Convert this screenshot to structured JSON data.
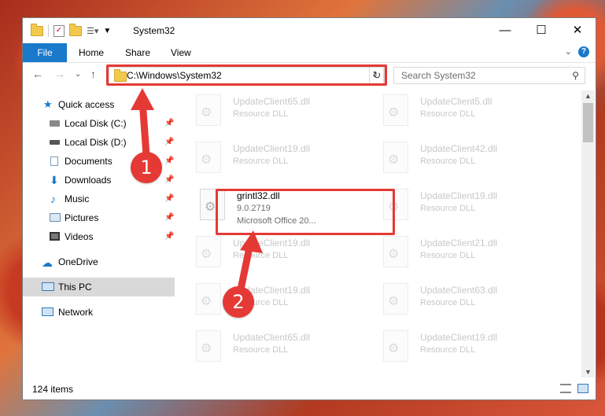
{
  "window": {
    "title": "System32",
    "buttons": {
      "minimize": "—",
      "maximize": "☐",
      "close": "✕"
    }
  },
  "ribbon": {
    "file": "File",
    "tabs": [
      "Home",
      "Share",
      "View"
    ],
    "help": "?"
  },
  "address": {
    "path": "C:\\Windows\\System32",
    "search_placeholder": "Search System32"
  },
  "nav": {
    "quick_access": "Quick access",
    "items": [
      {
        "label": "Local Disk (C:)",
        "pinned": true
      },
      {
        "label": "Local Disk (D:)",
        "pinned": true
      },
      {
        "label": "Documents",
        "pinned": true
      },
      {
        "label": "Downloads",
        "pinned": true
      },
      {
        "label": "Music",
        "pinned": true
      },
      {
        "label": "Pictures",
        "pinned": true
      },
      {
        "label": "Videos",
        "pinned": true
      }
    ],
    "onedrive": "OneDrive",
    "thispc": "This PC",
    "network": "Network"
  },
  "files": {
    "left": [
      {
        "name": "UpdateClient65.dll",
        "sub": "Resource DLL"
      },
      {
        "name": "UpdateClient19.dll",
        "sub": "Resource DLL"
      },
      {
        "name": "grintl32.dll",
        "sub": "9.0.2719",
        "sub2": "Microsoft Office 20..."
      },
      {
        "name": "UpdateClient19.dll",
        "sub": "Resource DLL"
      },
      {
        "name": "UpdateClient19.dll",
        "sub": "Resource DLL"
      },
      {
        "name": "UpdateClient65.dll",
        "sub": "Resource DLL"
      }
    ],
    "right": [
      {
        "name": "UpdateClient5.dll",
        "sub": "Resource DLL"
      },
      {
        "name": "UpdateClient42.dll",
        "sub": "Resource DLL"
      },
      {
        "name": "UpdateClient19.dll",
        "sub": "Resource DLL"
      },
      {
        "name": "UpdateClient21.dll",
        "sub": "Resource DLL"
      },
      {
        "name": "UpdateClient63.dll",
        "sub": "Resource DLL"
      },
      {
        "name": "UpdateClient19.dll",
        "sub": "Resource DLL"
      }
    ]
  },
  "status": {
    "count": "124 items"
  },
  "callouts": {
    "one": "1",
    "two": "2"
  },
  "colors": {
    "accent": "#1979ca",
    "highlight": "#e53935"
  }
}
